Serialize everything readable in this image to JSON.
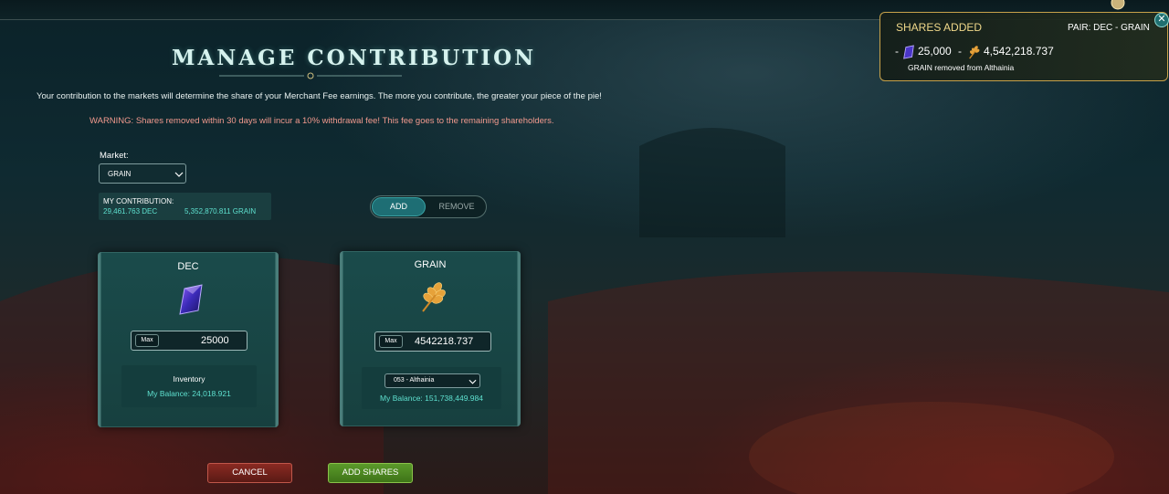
{
  "page": {
    "title": "MANAGE CONTRIBUTION",
    "intro": "Your contribution to the markets will determine the share of your Merchant Fee earnings. The more you contribute, the greater your piece of the pie!",
    "warning": "WARNING: Shares removed within 30 days will incur a 10% withdrawal fee! This fee goes to the remaining shareholders."
  },
  "market": {
    "label": "Market:",
    "selected": "GRAIN"
  },
  "contribution": {
    "label": "MY CONTRIBUTION:",
    "dec": "29,461.763 DEC",
    "grain": "5,352,870.811 GRAIN"
  },
  "toggle": {
    "add": "ADD",
    "remove": "REMOVE"
  },
  "dec_card": {
    "title": "DEC",
    "icon": "dec-crystal-icon",
    "max_label": "Max",
    "amount": "25000",
    "inventory_label": "Inventory",
    "balance": "My Balance: 24,018.921"
  },
  "grain_card": {
    "title": "GRAIN",
    "icon": "grain-wheat-icon",
    "max_label": "Max",
    "amount": "4542218.737",
    "land_selected": "053 - Althainia",
    "balance": "My Balance: 151,738,449.984"
  },
  "actions": {
    "cancel": "CANCEL",
    "add_shares": "ADD SHARES"
  },
  "toast": {
    "title": "SHARES ADDED",
    "pair": "PAIR: DEC - GRAIN",
    "dash1": "-",
    "dec_amount": "25,000",
    "dash2": "-",
    "grain_amount": "4,542,218.737",
    "message": "GRAIN removed from Althainia",
    "close": "✕"
  },
  "colors": {
    "accent_teal": "#5ee0cf",
    "warning": "#f29a8e",
    "toast_gold": "#c8a24a",
    "cancel_red": "#8a2a22",
    "add_green": "#5b9a2a"
  }
}
